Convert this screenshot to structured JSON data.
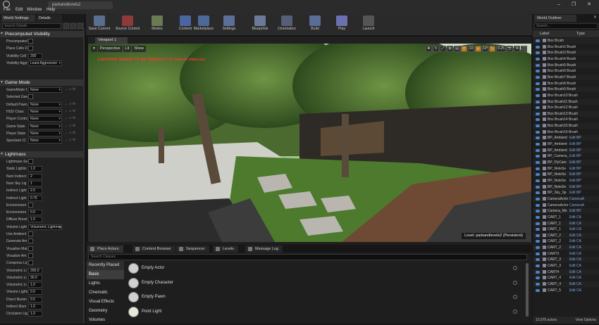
{
  "window": {
    "tab_title": "parkandlevels2",
    "controls": "– ❐ ✕"
  },
  "menu": [
    "File",
    "Edit",
    "Window",
    "Help"
  ],
  "left": {
    "tabs": [
      "World Settings",
      "Details"
    ],
    "search_placeholder": "Search Details",
    "sections": {
      "precomputed": "Precomputed Visibility",
      "game_mode": "Game Mode",
      "lightmass": "Lightmass"
    },
    "precomputed_rows": [
      {
        "label": "Precomputed Vis",
        "value": ""
      },
      {
        "label": "Place Cells Only",
        "value": ""
      },
      {
        "label": "Visibility Cell Si",
        "value": "200"
      },
      {
        "label": "Visibility Aggre",
        "value": "Least Aggressive"
      }
    ],
    "game_rows": [
      {
        "label": "GameMode Ov",
        "value": "None"
      },
      {
        "label": "Selected GameM",
        "value": ""
      },
      {
        "label": "Default Pawn",
        "value": "None"
      },
      {
        "label": "HUD Class",
        "value": "None"
      },
      {
        "label": "Player Contro",
        "value": "None"
      },
      {
        "label": "Game State",
        "value": "None"
      },
      {
        "label": "Player State",
        "value": "None"
      },
      {
        "label": "Spectator Cl",
        "value": "None"
      }
    ],
    "lightmass_rows": [
      {
        "label": "Lightmass Setti",
        "value": ""
      },
      {
        "label": "Static Lightin",
        "value": "1.0"
      },
      {
        "label": "Num Indirect",
        "value": "2"
      },
      {
        "label": "Num Sky Lig",
        "value": "1"
      },
      {
        "label": "Indirect Light",
        "value": "2.0"
      },
      {
        "label": "Indirect Light",
        "value": "0.75"
      },
      {
        "label": "Environment",
        "value": ""
      },
      {
        "label": "Environment",
        "value": "0.0"
      },
      {
        "label": "Diffuse Boost",
        "value": "1.0"
      },
      {
        "label": "Volume Light",
        "value": "Volumetric Lightmap"
      },
      {
        "label": "Use Ambient",
        "value": ""
      },
      {
        "label": "Generate Am",
        "value": ""
      },
      {
        "label": "Visualize Mat",
        "value": ""
      },
      {
        "label": "Visualize Am",
        "value": ""
      },
      {
        "label": "Compress Lig",
        "value": ""
      },
      {
        "label": "Volumetric Li",
        "value": "200.0"
      },
      {
        "label": "Volumetric Li",
        "value": "30.0"
      },
      {
        "label": "Volumetric Li",
        "value": "1.0"
      },
      {
        "label": "Volume Lightin",
        "value": "0.0"
      },
      {
        "label": "Direct Illumin",
        "value": "0.5"
      },
      {
        "label": "Indirect Illum",
        "value": "1.0"
      },
      {
        "label": "Occlusion Lig",
        "value": "1.0"
      }
    ]
  },
  "toolbar": [
    {
      "label": "Save Current",
      "icon": "save-icon",
      "color": "#5a6e90"
    },
    {
      "label": "Source Control",
      "icon": "source-control-icon",
      "color": "#8c3a3a"
    },
    {
      "label": "Modes",
      "icon": "modes-icon",
      "color": "#6a7a52"
    },
    {
      "label": "Content",
      "icon": "content-icon",
      "color": "#4a66a0"
    },
    {
      "label": "Marketplace",
      "icon": "marketplace-icon",
      "color": "#4b6a9a"
    },
    {
      "label": "Settings",
      "icon": "settings-icon",
      "color": "#5c6f98"
    },
    {
      "label": "Blueprints",
      "icon": "blueprints-icon",
      "color": "#6c7a9a"
    },
    {
      "label": "Cinematics",
      "icon": "cinematics-icon",
      "color": "#575f78"
    },
    {
      "label": "Build",
      "icon": "build-icon",
      "color": "#5b6c96"
    },
    {
      "label": "Play",
      "icon": "play-icon",
      "color": "#6a70b0"
    },
    {
      "label": "Launch",
      "icon": "launch-icon",
      "color": "#555"
    }
  ],
  "viewport": {
    "tab": "Viewport 1",
    "buttons": [
      "Perspective",
      "Lit",
      "Show"
    ],
    "warning": "LIGHTING NEEDS TO BE REBUILT (70 unbuilt objects)",
    "grid_value": "10",
    "angle_value": "10°",
    "scale_value": "0.25",
    "camera_speed": "4",
    "level": "Level: parkandlevels2 (Persistent)"
  },
  "bottom": {
    "tabs": [
      "Place Actors",
      "Content Browser",
      "Sequencer",
      "Levels",
      "Message Log"
    ],
    "search_placeholder": "Search Classes",
    "categories": [
      "Recently Placed",
      "Basic",
      "Lights",
      "Cinematic",
      "Visual Effects",
      "Geometry",
      "Volumes"
    ],
    "selected_category": "Basic",
    "items": [
      "Empty Actor",
      "Empty Character",
      "Empty Pawn",
      "Point Light"
    ]
  },
  "outliner": {
    "tab": "World Outliner",
    "search_placeholder": "Search...",
    "col_label": "Label",
    "col_type": "Type",
    "rows": [
      {
        "label": "Box Brush",
        "type": ""
      },
      {
        "label": "Box Brush2 Brush",
        "type": ""
      },
      {
        "label": "Box Brush3 Brush",
        "type": ""
      },
      {
        "label": "Box Brush4 Brush",
        "type": ""
      },
      {
        "label": "Box Brush5 Brush",
        "type": ""
      },
      {
        "label": "Box Brush6 Brush",
        "type": ""
      },
      {
        "label": "Box Brush7 Brush",
        "type": ""
      },
      {
        "label": "Box Brush8 Brush",
        "type": ""
      },
      {
        "label": "Box Brush9 Brush",
        "type": ""
      },
      {
        "label": "Box Brush10 Brush",
        "type": ""
      },
      {
        "label": "Box Brush11 Brush",
        "type": ""
      },
      {
        "label": "Box Brush12 Brush",
        "type": ""
      },
      {
        "label": "Box Brush13 Brush",
        "type": ""
      },
      {
        "label": "Box Brush14 Brush",
        "type": ""
      },
      {
        "label": "Box Brush15 Brush",
        "type": ""
      },
      {
        "label": "Box Brush16 Brush",
        "type": ""
      },
      {
        "label": "BP_Ambient",
        "type": "Edit BP"
      },
      {
        "label": "BP_Ambient",
        "type": "Edit BP"
      },
      {
        "label": "BP_Ambient",
        "type": "Edit BP"
      },
      {
        "label": "BP_Camera_",
        "type": "Edit BP"
      },
      {
        "label": "BP_FlyCam",
        "type": "Edit BP"
      },
      {
        "label": "BP_NoteSe",
        "type": "Edit BP"
      },
      {
        "label": "BP_NoteSe",
        "type": "Edit BP"
      },
      {
        "label": "BP_NoteSe",
        "type": "Edit BP"
      },
      {
        "label": "BP_NoteSe",
        "type": "Edit BP"
      },
      {
        "label": "BP_Sky_Sp",
        "type": "Edit BP"
      },
      {
        "label": "CameraActor",
        "type": "CameraA"
      },
      {
        "label": "CameraActor",
        "type": "CameraA"
      },
      {
        "label": "Camera_Mo",
        "type": "Edit BP"
      },
      {
        "label": "CART_1",
        "type": "Edit CA"
      },
      {
        "label": "CART_1",
        "type": "Edit CA"
      },
      {
        "label": "CART_1",
        "type": "Edit CA"
      },
      {
        "label": "CART_2",
        "type": "Edit CA"
      },
      {
        "label": "CART_2",
        "type": "Edit CA"
      },
      {
        "label": "CART_2",
        "type": "Edit CA"
      },
      {
        "label": "CART3",
        "type": "Edit CA"
      },
      {
        "label": "CART_3",
        "type": "Edit CA"
      },
      {
        "label": "CART_3",
        "type": "Edit CA"
      },
      {
        "label": "CART4",
        "type": "Edit CA"
      },
      {
        "label": "CART_4",
        "type": "Edit CA"
      },
      {
        "label": "CART_4",
        "type": "Edit CA"
      },
      {
        "label": "CART_5",
        "type": "Edit CA"
      }
    ],
    "footer": "12,975 actors",
    "view_options": "View Options"
  }
}
